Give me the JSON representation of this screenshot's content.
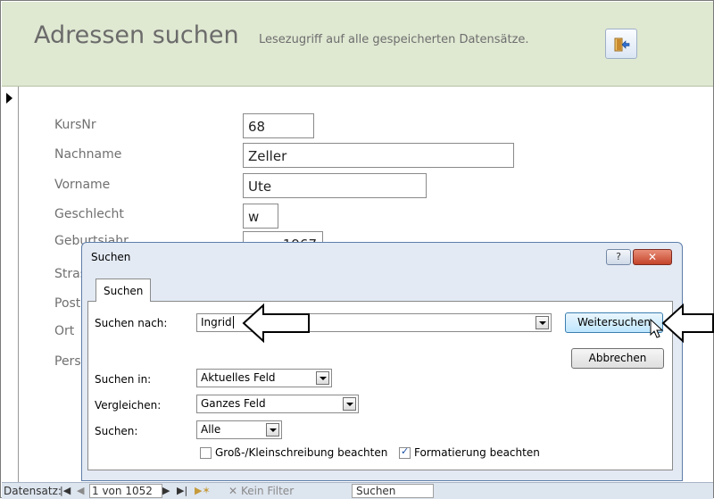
{
  "header": {
    "title": "Adressen suchen",
    "subtitle": "Lesezugriff auf alle gespeicherten Datensätze.",
    "exit_icon": "exit-door-icon"
  },
  "form": {
    "fields": [
      {
        "label": "KursNr",
        "value": "68"
      },
      {
        "label": "Nachname",
        "value": "Zeller"
      },
      {
        "label": "Vorname",
        "value": "Ute"
      },
      {
        "label": "Geschlecht",
        "value": "w"
      },
      {
        "label": "Geburtsjahr",
        "value": "1967"
      },
      {
        "label": "Strasse",
        "value": ""
      },
      {
        "label": "Postleitzahl",
        "value": ""
      },
      {
        "label": "Ort",
        "value": ""
      },
      {
        "label": "Personalnummer",
        "value": ""
      }
    ]
  },
  "dialog": {
    "title": "Suchen",
    "help_label": "?",
    "close_label": "✕",
    "tab_label": "Suchen",
    "search_for_label": "Suchen nach:",
    "search_for_value": "Ingrid",
    "search_in_label": "Suchen in:",
    "search_in_value": "Aktuelles Feld",
    "compare_label": "Vergleichen:",
    "compare_value": "Ganzes Feld",
    "direction_label": "Suchen:",
    "direction_value": "Alle",
    "find_next_label": "Weitersuchen",
    "cancel_label": "Abbrechen",
    "match_case_label": "Groß-/Kleinschreibung beachten",
    "match_case_checked": false,
    "format_label": "Formatierung beachten",
    "format_checked": true
  },
  "status": {
    "record_label": "Datensatz:",
    "position": "1 von 1052",
    "filter_label": "Kein Filter",
    "search_label": "Suchen"
  }
}
